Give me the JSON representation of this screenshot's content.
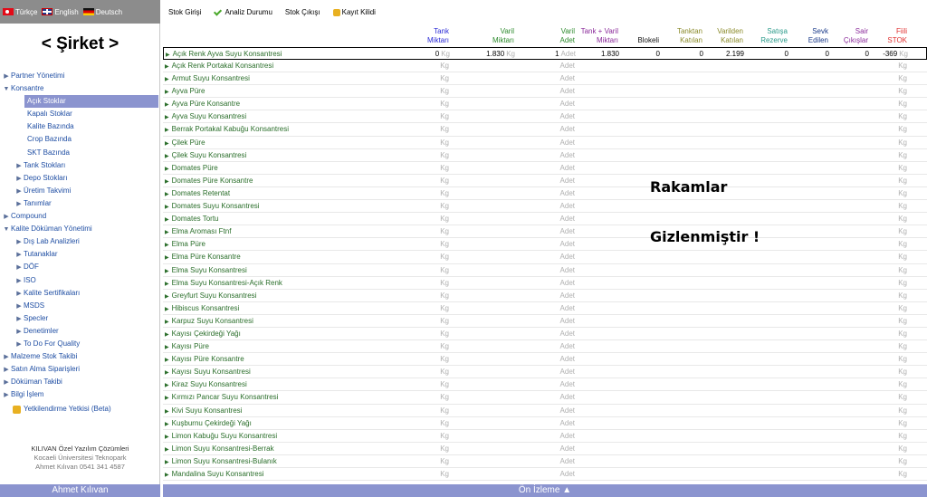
{
  "languages": [
    {
      "label": "Türkçe",
      "flag": "tr"
    },
    {
      "label": "English",
      "flag": "gb"
    },
    {
      "label": "Deutsch",
      "flag": "de"
    }
  ],
  "company": "< Şirket >",
  "nav": [
    {
      "label": "Partner Yönetimi",
      "level": 0,
      "arrow": "▶"
    },
    {
      "label": "Konsantre",
      "level": 0,
      "arrow": "▼"
    },
    {
      "label": "Açık Stoklar",
      "level": "leaf",
      "active": true
    },
    {
      "label": "Kapalı Stoklar",
      "level": "leaf"
    },
    {
      "label": "Kalite Bazında",
      "level": "leaf"
    },
    {
      "label": "Crop Bazında",
      "level": "leaf"
    },
    {
      "label": "SKT Bazında",
      "level": "leaf"
    },
    {
      "label": "Tank Stokları",
      "level": 1,
      "arrow": "▶"
    },
    {
      "label": "Depo Stokları",
      "level": 1,
      "arrow": "▶"
    },
    {
      "label": "Üretim Takvimi",
      "level": 1,
      "arrow": "▶"
    },
    {
      "label": "Tanımlar",
      "level": 1,
      "arrow": "▶"
    },
    {
      "label": "Compound",
      "level": 0,
      "arrow": "▶"
    },
    {
      "label": "Kalite Döküman Yönetimi",
      "level": 0,
      "arrow": "▼"
    },
    {
      "label": "Dış Lab Analizleri",
      "level": 1,
      "arrow": "▶"
    },
    {
      "label": "Tutanaklar",
      "level": 1,
      "arrow": "▶"
    },
    {
      "label": "DÖF",
      "level": 1,
      "arrow": "▶"
    },
    {
      "label": "ISO",
      "level": 1,
      "arrow": "▶"
    },
    {
      "label": "Kalite Sertifikaları",
      "level": 1,
      "arrow": "▶"
    },
    {
      "label": "MSDS",
      "level": 1,
      "arrow": "▶"
    },
    {
      "label": "Specler",
      "level": 1,
      "arrow": "▶"
    },
    {
      "label": "Denetimler",
      "level": 1,
      "arrow": "▶"
    },
    {
      "label": "To Do For Quality",
      "level": 1,
      "arrow": "▶"
    },
    {
      "label": "Malzeme Stok Takibi",
      "level": 0,
      "arrow": "▶"
    },
    {
      "label": "Satın Alma Siparişleri",
      "level": 0,
      "arrow": "▶"
    },
    {
      "label": "Döküman Takibi",
      "level": 0,
      "arrow": "▶"
    },
    {
      "label": "Bilgi İşlem",
      "level": 0,
      "arrow": "▶"
    },
    {
      "label": "Yetkilendirme Yetkisi (Beta)",
      "level": "locked"
    }
  ],
  "footer": {
    "line1": "KILIVAN Özel Yazılım Çözümleri",
    "line2": "Kocaeli Üniversitesi Teknopark",
    "line3": "Ahmet Kılıvan 0541 341 4587"
  },
  "user": "Ahmet Kılıvan",
  "toolbar": {
    "stock_in": "Stok Girişi",
    "analysis": "Analiz Durumu",
    "stock_out": "Stok Çıkışı",
    "record_lock": "Kayıt Kilidi"
  },
  "columns": [
    {
      "l1": "Tank",
      "l2": "Miktarı",
      "color": "#2b2bd6"
    },
    {
      "l1": "Varil",
      "l2": "Miktarı",
      "color": "#2e8b2e"
    },
    {
      "l1": "Varil",
      "l2": "Adet",
      "color": "#2e8b2e"
    },
    {
      "l1": "Tank + Varil",
      "l2": "Miktarı",
      "color": "#8a2a9a"
    },
    {
      "l1": "Blokeli",
      "l2": "",
      "color": "#111"
    },
    {
      "l1": "Tanktan",
      "l2": "Katılan",
      "color": "#8a8a2a"
    },
    {
      "l1": "Varilden",
      "l2": "Katılan",
      "color": "#8a8a2a"
    },
    {
      "l1": "Satışa",
      "l2": "Rezerve",
      "color": "#2a9a8a"
    },
    {
      "l1": "Sevk",
      "l2": "Edilen",
      "color": "#1a3a8a"
    },
    {
      "l1": "Sair",
      "l2": "Çıkışlar",
      "color": "#8a2a9a"
    },
    {
      "l1": "Fiili",
      "l2": "STOK",
      "color": "#e03030"
    }
  ],
  "units": {
    "kg": "Kg",
    "adet": "Adet"
  },
  "first_row": {
    "name": "Açık Renk Ayva Suyu Konsantresi",
    "tank": "0",
    "varil": "1.830",
    "varil_adet": "1",
    "total": "1.830",
    "blokeli": "0",
    "tanktan": "0",
    "varilden": "2.199",
    "satisa": "0",
    "sevk": "0",
    "sair": "0",
    "fiili": "-369"
  },
  "products": [
    "Açık Renk Portakal Konsantresi",
    "Armut Suyu Konsantresi",
    "Ayva Püre",
    "Ayva Püre Konsantre",
    "Ayva Suyu Konsantresi",
    "Berrak Portakal Kabuğu Konsantresi",
    "Çilek Püre",
    "Çilek Suyu Konsantresi",
    "Domates Püre",
    "Domates Püre Konsantre",
    "Domates Retentat",
    "Domates Suyu Konsantresi",
    "Domates Tortu",
    "Elma Aroması Ftnf",
    "Elma Püre",
    "Elma Püre Konsantre",
    "Elma Suyu Konsantresi",
    "Elma Suyu Konsantresi-Açık Renk",
    "Greyfurt Suyu Konsantresi",
    "Hibiscus Konsantresi",
    "Karpuz Suyu Konsantresi",
    "Kayısı Çekirdeği Yağı",
    "Kayısı Püre",
    "Kayısı Püre Konsantre",
    "Kayısı Suyu Konsantresi",
    "Kiraz Suyu Konsantresi",
    "Kırmızı Pancar Suyu Konsantresi",
    "Kivi Suyu Konsantresi",
    "Kuşburnu Çekirdeği Yağı",
    "Limon Kabuğu Suyu Konsantresi",
    "Limon Suyu Konsantresi-Berrak",
    "Limon Suyu Konsantresi-Bulanık",
    "Mandalina Suyu Konsantresi"
  ],
  "overlay": {
    "line1": "Rakamlar",
    "line2": "Gizlenmiştir !"
  },
  "preview": "Ön İzleme ▲"
}
